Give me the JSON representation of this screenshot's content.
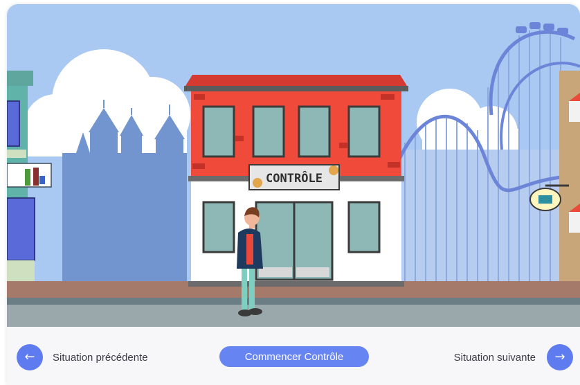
{
  "scene": {
    "sign_text": "CONTRÔLE"
  },
  "footer": {
    "prev_label": "Situation précédente",
    "start_label": "Commencer Contrôle",
    "next_label": "Situation suivante"
  },
  "icons": {
    "prev": "arrow-left-icon",
    "next": "arrow-right-icon"
  },
  "colors": {
    "sky": "#a9c8f2",
    "building_red": "#ef4a3a",
    "button_blue": "#6784f3"
  }
}
